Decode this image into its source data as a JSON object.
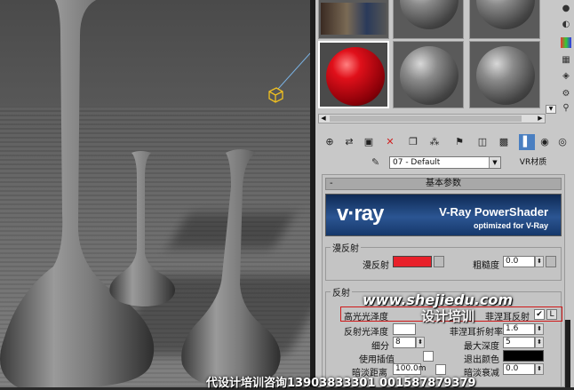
{
  "material_editor": {
    "material_name": "07 - Default",
    "material_type": "VR材质",
    "rollout_title": "基本参数",
    "banner": {
      "logo_text": "v·ray",
      "title": "V-Ray PowerShader",
      "subtitle": "optimized for V-Ray"
    },
    "diffuse_group": {
      "label": "漫反射",
      "diffuse_label": "漫反射",
      "diffuse_color": "#e8202a",
      "roughness_label": "粗糙度",
      "roughness_value": "0.0"
    },
    "reflect_group": {
      "label": "反射",
      "highlight_label": "高光光泽度",
      "fresnel_label": "菲涅耳反射",
      "fresnel_checked": "✔",
      "lock_label": "L",
      "reflect_gloss_label": "反射光泽度",
      "fresnel_ior_label": "菲涅耳折射率",
      "fresnel_ior_value": "1.6",
      "subdivs_label": "细分",
      "subdivs_value": "8",
      "max_depth_label": "最大深度",
      "max_depth_value": "5",
      "use_interp_label": "使用插值",
      "exit_color_label": "退出颜色",
      "exit_color": "#000000",
      "dim_distance_label": "暗淡距离",
      "dim_distance_value": "100.0m",
      "dim_falloff_label": "暗淡衰减",
      "dim_falloff_value": "0.0"
    }
  },
  "watermarks": {
    "site": "www.shejiedu.com",
    "school": "设计培训",
    "contact": "代设计培训咨询13903833301 001587879379"
  },
  "colors": {
    "accent_blue": "#4a7fc1",
    "panel_bg": "#c8c8c8",
    "banner_bg": "#1c3f72",
    "highlight_box": "#d01818"
  }
}
